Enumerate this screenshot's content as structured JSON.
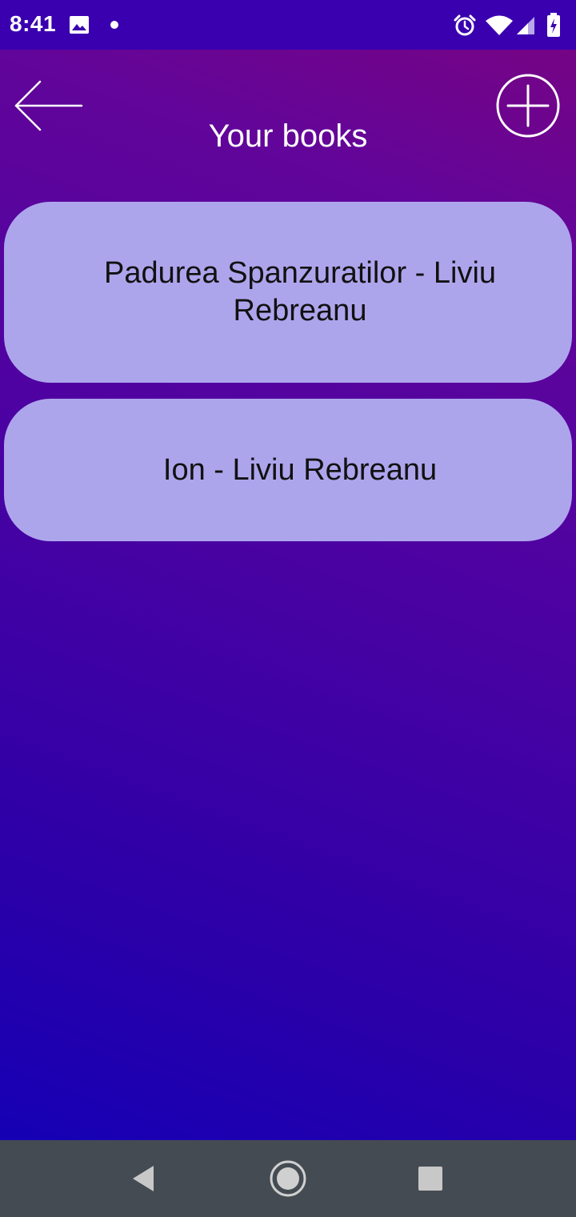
{
  "status_bar": {
    "time": "8:41",
    "icons": [
      "image-icon",
      "notification-dot-icon",
      "alarm-icon",
      "wifi-icon",
      "cell-signal-icon",
      "battery-charging-icon"
    ]
  },
  "header": {
    "title": "Your books",
    "back_icon": "arrow-left-icon",
    "add_icon": "plus-circle-icon"
  },
  "books": [
    {
      "label": "Padurea Spanzuratilor - Liviu Rebreanu"
    },
    {
      "label": "Ion - Liviu Rebreanu"
    }
  ],
  "colors": {
    "status_bar": "#3a00b0",
    "card_background": "#ada5ec",
    "nav_bar": "#454b52",
    "gradient_top": "#7a0480",
    "gradient_bottom": "#0f00b8"
  },
  "nav_bar": {
    "icons": [
      "back-triangle-icon",
      "home-circle-icon",
      "recents-square-icon"
    ]
  }
}
